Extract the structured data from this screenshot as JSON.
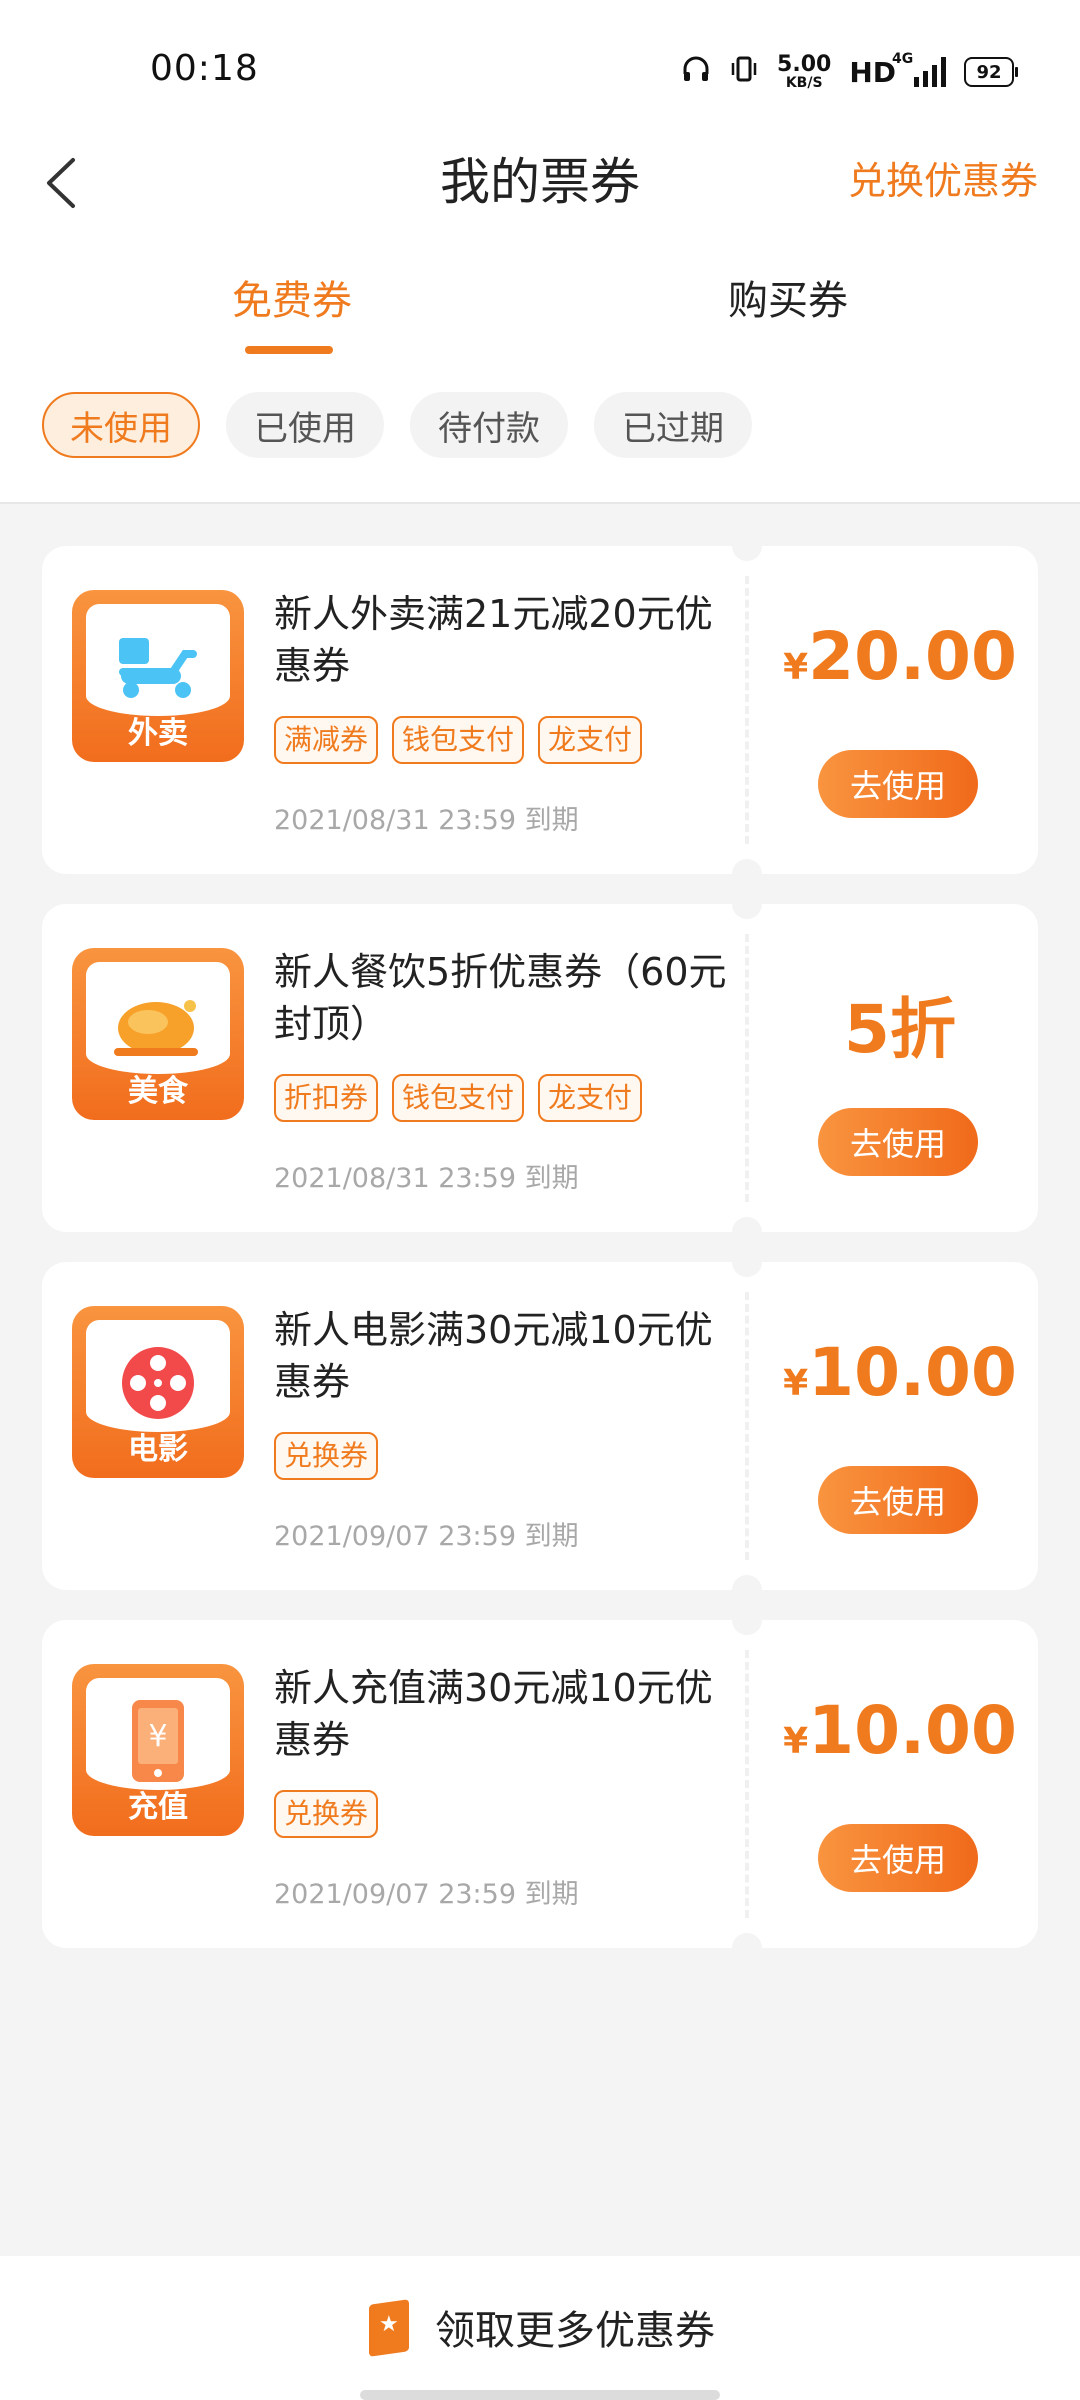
{
  "status_bar": {
    "time": "00:18",
    "net_speed": "5.00",
    "net_unit": "KB/S",
    "hd": "HD",
    "signal_label": "4G",
    "battery": "92"
  },
  "header": {
    "title": "我的票券",
    "redeem_label": "兑换优惠券"
  },
  "tabs": {
    "free": "免费券",
    "paid": "购买券"
  },
  "filters": [
    "未使用",
    "已使用",
    "待付款",
    "已过期"
  ],
  "coupons": [
    {
      "category": "外卖",
      "title": "新人外卖满21元减20元优惠券",
      "tags": [
        "满减券",
        "钱包支付",
        "龙支付"
      ],
      "expire": "2021/08/31 23:59 到期",
      "currency": "¥",
      "amount": "20.00",
      "button": "去使用"
    },
    {
      "category": "美食",
      "title": "新人餐饮5折优惠券（60元封顶）",
      "tags": [
        "折扣券",
        "钱包支付",
        "龙支付"
      ],
      "expire": "2021/08/31 23:59 到期",
      "currency": "",
      "amount": "5折",
      "button": "去使用"
    },
    {
      "category": "电影",
      "title": "新人电影满30元减10元优惠券",
      "tags": [
        "兑换券"
      ],
      "expire": "2021/09/07 23:59 到期",
      "currency": "¥",
      "amount": "10.00",
      "button": "去使用"
    },
    {
      "category": "充值",
      "title": "新人充值满30元减10元优惠券",
      "tags": [
        "兑换券"
      ],
      "expire": "2021/09/07 23:59 到期",
      "currency": "¥",
      "amount": "10.00",
      "button": "去使用"
    }
  ],
  "bottom": {
    "cta": "领取更多优惠券"
  },
  "colors": {
    "accent": "#f07b1e",
    "background": "#f4f4f4"
  }
}
